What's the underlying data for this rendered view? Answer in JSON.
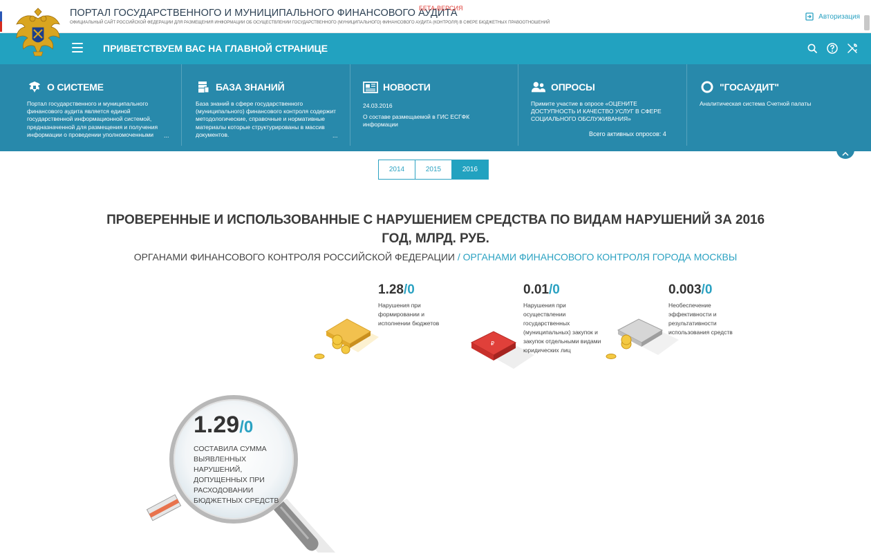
{
  "header": {
    "title": "ПОРТАЛ ГОСУДАРСТВЕННОГО И МУНИЦИПАЛЬНОГО ФИНАНСОВОГО АУДИТА",
    "beta": "БЕТА-ВЕРСИЯ",
    "subtitle": "ОФИЦИАЛЬНЫЙ САЙТ РОССИЙСКОЙ ФЕДЕРАЦИИ ДЛЯ РАЗМЕЩЕНИЯ ИНФОРМАЦИИ ОБ ОСУЩЕСТВЛЕНИИ ГОСУДАРСТВЕННОГО (МУНИЦИПАЛЬНОГО) ФИНАНСОВОГО АУДИТА (КОНТРОЛЯ) В СФЕРЕ БЮДЖЕТНЫХ ПРАВООТНОШЕНИЙ",
    "auth_label": "Авторизация"
  },
  "navbar": {
    "welcome": "ПРИВЕТСТВУЕМ ВАС НА ГЛАВНОЙ СТРАНИЦЕ",
    "icons": [
      "search-icon",
      "help-icon",
      "tools-icon"
    ]
  },
  "panel": {
    "about": {
      "title": "О СИСТЕМЕ",
      "text": "Портал государственного и муниципального финансового аудита является единой государственной информационной системой, предназначенной для размещения и получения информации о проведении уполномоченными",
      "more": "..."
    },
    "knowledge": {
      "title": "БАЗА ЗНАНИЙ",
      "text": "База знаний в сфере государственного (муниципального) финансового контроля содержит методологические, справочные и нормативные материалы которые структурированы в массив документов.",
      "more": "..."
    },
    "news": {
      "title": "НОВОСТИ",
      "date": "24.03.2016",
      "text": "О составе размещаемой в ГИС ЕСГФК информации"
    },
    "polls": {
      "title": "ОПРОСЫ",
      "text": "Примите участие в опросе «ОЦЕНИТЕ ДОСТУПНОСТЬ И КАЧЕСТВО УСЛУГ В СФЕРЕ СОЦИАЛЬНОГО ОБСЛУЖИВАНИЯ»",
      "total": "Всего активных опросов: 4"
    },
    "gosaudit": {
      "title": "\"ГОСАУДИТ\"",
      "text": "Аналитическая система Счетной палаты"
    }
  },
  "years": {
    "items": [
      "2014",
      "2015",
      "2016"
    ],
    "active": "2016"
  },
  "main": {
    "headline": "ПРОВЕРЕННЫЕ И ИСПОЛЬЗОВАННЫЕ С НАРУШЕНИЕМ СРЕДСТВА ПО ВИДАМ НАРУШЕНИЙ ЗА 2016 ГОД, МЛРД. РУБ.",
    "sub_primary": "ОРГАНАМИ ФИНАНСОВОГО КОНТРОЛЯ РОССИЙСКОЙ ФЕДЕРАЦИИ",
    "sub_alt": " / ОРГАНАМИ ФИНАНСОВОГО КОНТРОЛЯ ГОРОДА МОСКВЫ"
  },
  "stats": [
    {
      "value": "1.28",
      "alt": "/0",
      "desc": "Нарушения при формировании и исполнении бюджетов",
      "color": "#f2c14e"
    },
    {
      "value": "0.01",
      "alt": "/0",
      "desc": "Нарушения при осуществлении государственных (муниципальных) закупок и закупок отдельными видами юридических лиц",
      "color": "#e0403a"
    },
    {
      "value": "0.003",
      "alt": "/0",
      "desc": "Необеспечение эффективности и результативности использования средств",
      "color": "#bdbdbd"
    }
  ],
  "total": {
    "value": "1.29",
    "alt": "/0",
    "desc": "СОСТАВИЛА СУММА ВЫЯВЛЕННЫХ НАРУШЕНИЙ, ДОПУЩЕННЫХ ПРИ РАСХОДОВАНИИ БЮДЖЕТНЫХ СРЕДСТВ"
  },
  "colors": {
    "accent": "#22a2c0",
    "panel": "#2889ab",
    "beta": "#e0403a",
    "link": "#2ba2c2"
  }
}
